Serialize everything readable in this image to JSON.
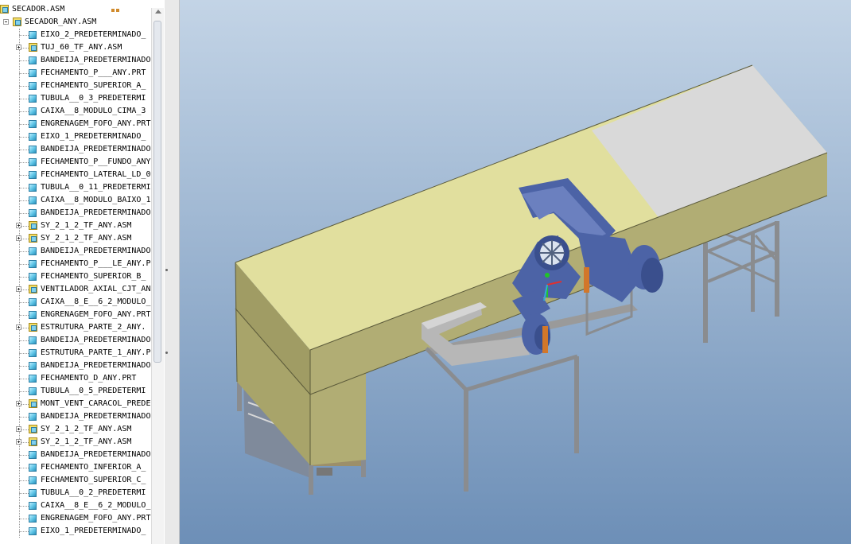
{
  "model_tree": {
    "items": [
      {
        "label": "SECADOR.ASM",
        "type": "asm",
        "level": 0,
        "expander": "minus"
      },
      {
        "label": "SECADOR_ANY.ASM",
        "type": "asm",
        "level": 1,
        "expander": "minus"
      },
      {
        "label": "EIXO_2_PREDETERMINADO_",
        "type": "part",
        "level": 2,
        "expander": "none"
      },
      {
        "label": "TUJ_60_TF_ANY.ASM",
        "type": "asm",
        "level": 2,
        "expander": "plus"
      },
      {
        "label": "BANDEIJA_PREDETERMINADO",
        "type": "part",
        "level": 2,
        "expander": "none"
      },
      {
        "label": "FECHAMENTO_P___ANY.PRT",
        "type": "part",
        "level": 2,
        "expander": "none"
      },
      {
        "label": "FECHAMENTO_SUPERIOR_A_",
        "type": "part",
        "level": 2,
        "expander": "none"
      },
      {
        "label": "TUBULA__0_3_PREDETERMI",
        "type": "part",
        "level": 2,
        "expander": "none"
      },
      {
        "label": "CAIXA__8_MODULO_CIMA_3",
        "type": "part",
        "level": 2,
        "expander": "none"
      },
      {
        "label": "ENGRENAGEM_FOFO_ANY.PRT",
        "type": "part",
        "level": 2,
        "expander": "none"
      },
      {
        "label": "EIXO_1_PREDETERMINADO_",
        "type": "part",
        "level": 2,
        "expander": "none"
      },
      {
        "label": "BANDEIJA_PREDETERMINADO",
        "type": "part",
        "level": 2,
        "expander": "none"
      },
      {
        "label": "FECHAMENTO_P__FUNDO_ANY",
        "type": "part",
        "level": 2,
        "expander": "none"
      },
      {
        "label": "FECHAMENTO_LATERAL_LD_0",
        "type": "part",
        "level": 2,
        "expander": "none"
      },
      {
        "label": "TUBULA__0_11_PREDETERMI",
        "type": "part",
        "level": 2,
        "expander": "none"
      },
      {
        "label": "CAIXA__8_MODULO_BAIXO_1",
        "type": "part",
        "level": 2,
        "expander": "none"
      },
      {
        "label": "BANDEIJA_PREDETERMINADO",
        "type": "part",
        "level": 2,
        "expander": "none"
      },
      {
        "label": "SY_2_1_2_TF_ANY.ASM",
        "type": "asm",
        "level": 2,
        "expander": "plus"
      },
      {
        "label": "SY_2_1_2_TF_ANY.ASM",
        "type": "asm",
        "level": 2,
        "expander": "plus"
      },
      {
        "label": "BANDEIJA_PREDETERMINADO",
        "type": "part",
        "level": 2,
        "expander": "none"
      },
      {
        "label": "FECHAMENTO_P___LE_ANY.P",
        "type": "part",
        "level": 2,
        "expander": "none"
      },
      {
        "label": "FECHAMENTO_SUPERIOR_B_",
        "type": "part",
        "level": 2,
        "expander": "none"
      },
      {
        "label": "VENTILADOR_AXIAL_CJT_AN",
        "type": "asm",
        "level": 2,
        "expander": "plus"
      },
      {
        "label": "CAIXA__8_E__6_2_MODULO_",
        "type": "part",
        "level": 2,
        "expander": "none"
      },
      {
        "label": "ENGRENAGEM_FOFO_ANY.PRT",
        "type": "part",
        "level": 2,
        "expander": "none"
      },
      {
        "label": "ESTRUTURA_PARTE_2_ANY.",
        "type": "asm",
        "level": 2,
        "expander": "plus"
      },
      {
        "label": "BANDEIJA_PREDETERMINADO",
        "type": "part",
        "level": 2,
        "expander": "none"
      },
      {
        "label": "ESTRUTURA_PARTE_1_ANY.P",
        "type": "part",
        "level": 2,
        "expander": "none"
      },
      {
        "label": "BANDEIJA_PREDETERMINADO",
        "type": "part",
        "level": 2,
        "expander": "none"
      },
      {
        "label": "FECHAMENTO_D_ANY.PRT",
        "type": "part",
        "level": 2,
        "expander": "none"
      },
      {
        "label": "TUBULA__0_5_PREDETERMI",
        "type": "part",
        "level": 2,
        "expander": "none"
      },
      {
        "label": "MONT_VENT_CARACOL_PREDE",
        "type": "asm",
        "level": 2,
        "expander": "plus"
      },
      {
        "label": "BANDEIJA_PREDETERMINADO",
        "type": "part",
        "level": 2,
        "expander": "none"
      },
      {
        "label": "SY_2_1_2_TF_ANY.ASM",
        "type": "asm",
        "level": 2,
        "expander": "plus"
      },
      {
        "label": "SY_2_1_2_TF_ANY.ASM",
        "type": "asm",
        "level": 2,
        "expander": "plus"
      },
      {
        "label": "BANDEIJA_PREDETERMINADO",
        "type": "part",
        "level": 2,
        "expander": "none"
      },
      {
        "label": "FECHAMENTO_INFERIOR_A_",
        "type": "part",
        "level": 2,
        "expander": "none"
      },
      {
        "label": "FECHAMENTO_SUPERIOR_C_",
        "type": "part",
        "level": 2,
        "expander": "none"
      },
      {
        "label": "TUBULA__0_2_PREDETERMI",
        "type": "part",
        "level": 2,
        "expander": "none"
      },
      {
        "label": "CAIXA__8_E__6_2_MODULO_",
        "type": "part",
        "level": 2,
        "expander": "none"
      },
      {
        "label": "ENGRENAGEM_FOFO_ANY.PRT",
        "type": "part",
        "level": 2,
        "expander": "none"
      },
      {
        "label": "EIXO_1_PREDETERMINADO_",
        "type": "part",
        "level": 2,
        "expander": "none"
      }
    ]
  },
  "colors": {
    "viewport_top": "#c3d4e6",
    "viewport_bottom": "#6d8fb7",
    "panel_top_yellow": "#e1df9e",
    "panel_top_gray": "#d9d9d9",
    "panel_side": "#b1ad74",
    "frame_steel": "#8a8c8f",
    "fan_blue": "#4c63a6",
    "duct_gray": "#b7b7b7",
    "motor_orange": "#d2772a"
  }
}
